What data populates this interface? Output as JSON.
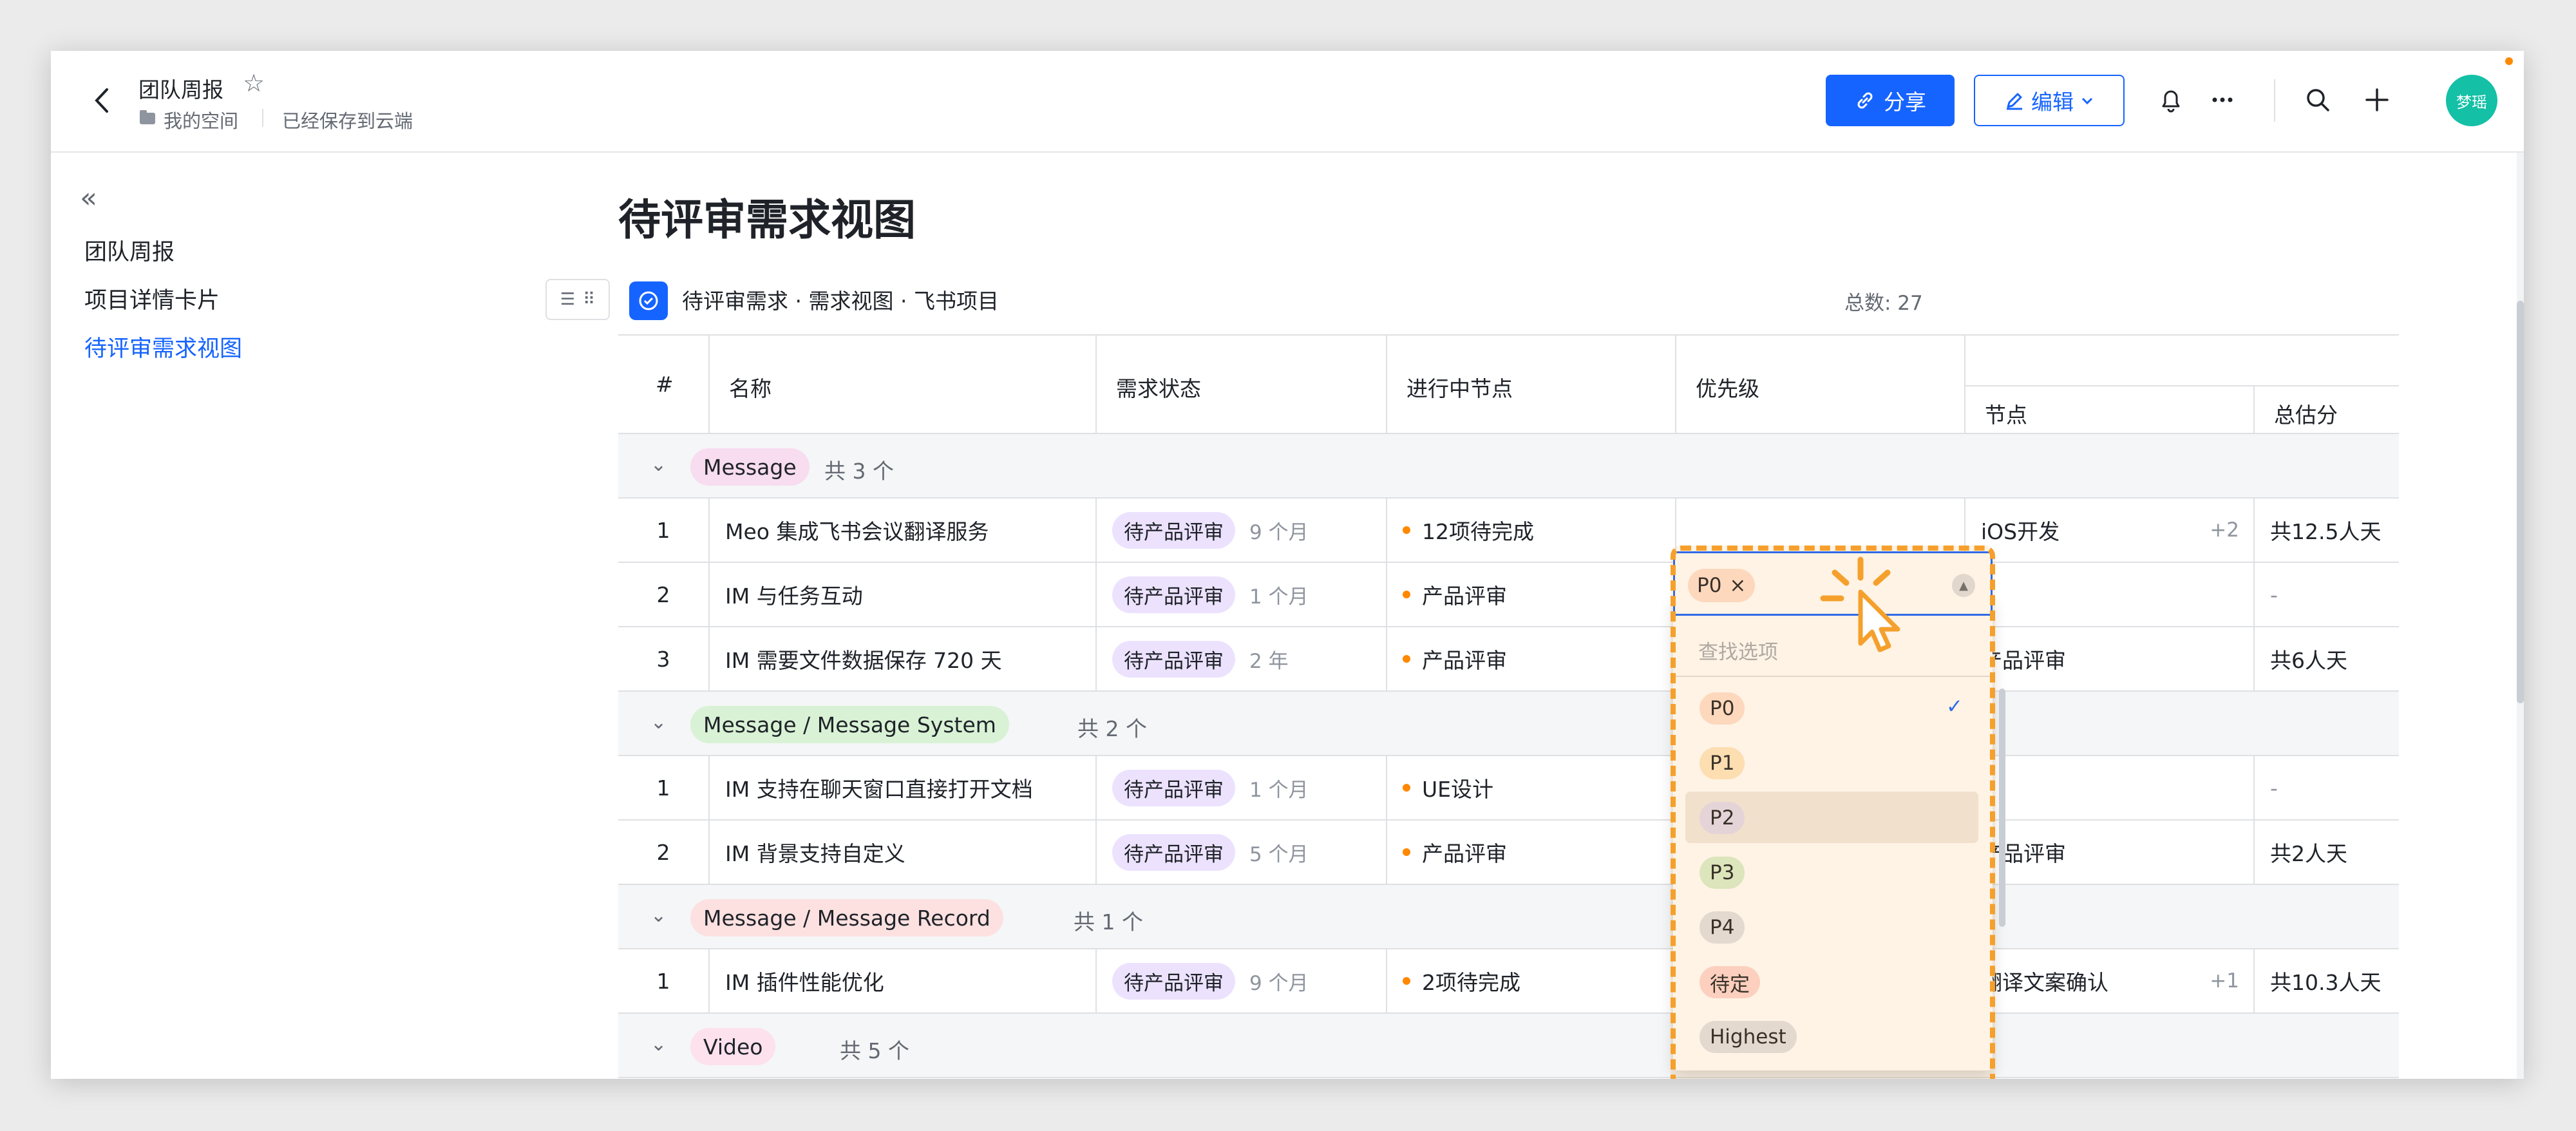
{
  "header": {
    "title": "团队周报",
    "breadcrumb": "我的空间",
    "saved": "已经保存到云端",
    "share_label": "分享",
    "edit_label": "编辑",
    "avatar_text": "梦瑶"
  },
  "sidebar": {
    "items": [
      {
        "label": "团队周报"
      },
      {
        "label": "项目详情卡片"
      },
      {
        "label": "待评审需求视图"
      }
    ]
  },
  "main": {
    "title": "待评审需求视图",
    "view_title": "待评审需求 · 需求视图 · 飞书项目",
    "total": "总数: 27"
  },
  "table": {
    "columns": {
      "num": "#",
      "name": "名称",
      "status": "需求状态",
      "progress": "进行中节点",
      "priority": "优先级",
      "node": "节点",
      "estimate": "总估分"
    },
    "groups": [
      {
        "label": "Message",
        "count": "共 3 个"
      },
      {
        "label": "Message / Message System",
        "count": "共 2 个"
      },
      {
        "label": "Message / Message Record",
        "count": "共 1 个"
      },
      {
        "label": "Video",
        "count": "共 5 个"
      }
    ],
    "rows": [
      {
        "num": "1",
        "name": "Meo 集成飞书会议翻译服务",
        "status": "待产品评审",
        "time": "9 个月",
        "progress": "12项待完成",
        "node": "iOS开发",
        "node_extra": "+2",
        "estimate": "共12.5人天"
      },
      {
        "num": "2",
        "name": "IM 与任务互动",
        "status": "待产品评审",
        "time": "1 个月",
        "progress": "产品评审",
        "node": "-",
        "node_extra": "",
        "estimate": "-"
      },
      {
        "num": "3",
        "name": "IM 需要文件数据保存 720 天",
        "status": "待产品评审",
        "time": "2 年",
        "progress": "产品评审",
        "node": "产品评审",
        "node_extra": "",
        "estimate": "共6人天"
      },
      {
        "num": "1",
        "name": "IM 支持在聊天窗口直接打开文档",
        "status": "待产品评审",
        "time": "1 个月",
        "progress": "UE设计",
        "node": "-",
        "node_extra": "",
        "estimate": "-"
      },
      {
        "num": "2",
        "name": "IM 背景支持自定义",
        "status": "待产品评审",
        "time": "5 个月",
        "progress": "产品评审",
        "node": "产品评审",
        "node_extra": "",
        "estimate": "共2人天"
      },
      {
        "num": "1",
        "name": "IM 插件性能优化",
        "status": "待产品评审",
        "time": "9 个月",
        "progress": "2项待完成",
        "node": "翻译文案确认",
        "node_extra": "+1",
        "estimate": "共10.3人天"
      }
    ]
  },
  "priority_dropdown": {
    "selected": "P0",
    "search_placeholder": "查找选项",
    "options": [
      {
        "label": "P0",
        "color": "#fee1d2",
        "checked": true
      },
      {
        "label": "P1",
        "color": "#fde7c4"
      },
      {
        "label": "P2",
        "color": "#e3dcf0"
      },
      {
        "label": "P3",
        "color": "#d9f0d0"
      },
      {
        "label": "P4",
        "color": "#e2e2e6"
      },
      {
        "label": "待定",
        "color": "#fdd6d3"
      },
      {
        "label": "Highest",
        "color": "#e2e2e6"
      }
    ]
  },
  "colors": {
    "accent": "#1664ff",
    "group_message": "#f8dcef",
    "group_system": "#d9f2d5",
    "group_record": "#fde1e1",
    "group_video": "#fde1ed",
    "status_tag": "#ece2fe",
    "highlight": "#f5a02c"
  }
}
